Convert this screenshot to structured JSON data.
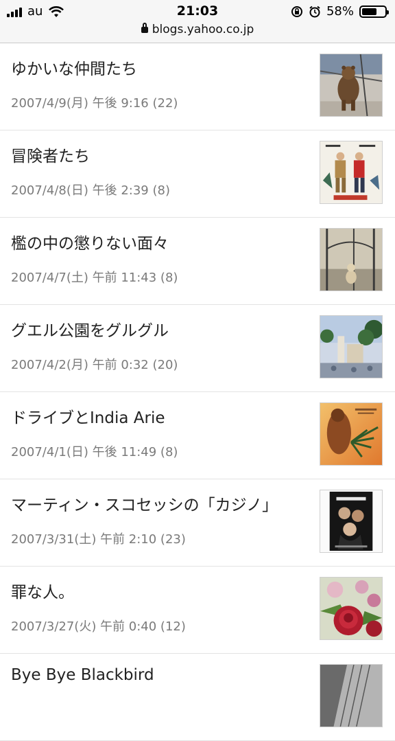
{
  "status_bar": {
    "carrier": "au",
    "time": "21:03",
    "battery": "58%",
    "battery_level": 0.58,
    "url": "blogs.yahoo.co.jp"
  },
  "entries": [
    {
      "title": "ゆかいな仲間たち",
      "meta": "2007/4/9(月) 午後 9:16 (22)",
      "thumb": "bear-photo"
    },
    {
      "title": "冒険者たち",
      "meta": "2007/4/8(日) 午後 2:39 (8)",
      "thumb": "movie-poster"
    },
    {
      "title": "檻の中の懲りない面々",
      "meta": "2007/4/7(土) 午前 11:43 (8)",
      "thumb": "monkey-cage-photo"
    },
    {
      "title": "グエル公園をグルグル",
      "meta": "2007/4/2(月) 午前 0:32 (20)",
      "thumb": "park-guell-photo"
    },
    {
      "title": "ドライブとIndia Arie",
      "meta": "2007/4/1(日) 午後 11:49 (8)",
      "thumb": "album-cover"
    },
    {
      "title": "マーティン・スコセッシの「カジノ」",
      "meta": "2007/3/31(土) 午前 2:10 (23)",
      "thumb": "casino-poster"
    },
    {
      "title": "罪な人。",
      "meta": "2007/3/27(火) 午前 0:40 (12)",
      "thumb": "rose-photo"
    },
    {
      "title": "Bye Bye Blackbird",
      "meta": "",
      "thumb": "building-photo"
    }
  ]
}
